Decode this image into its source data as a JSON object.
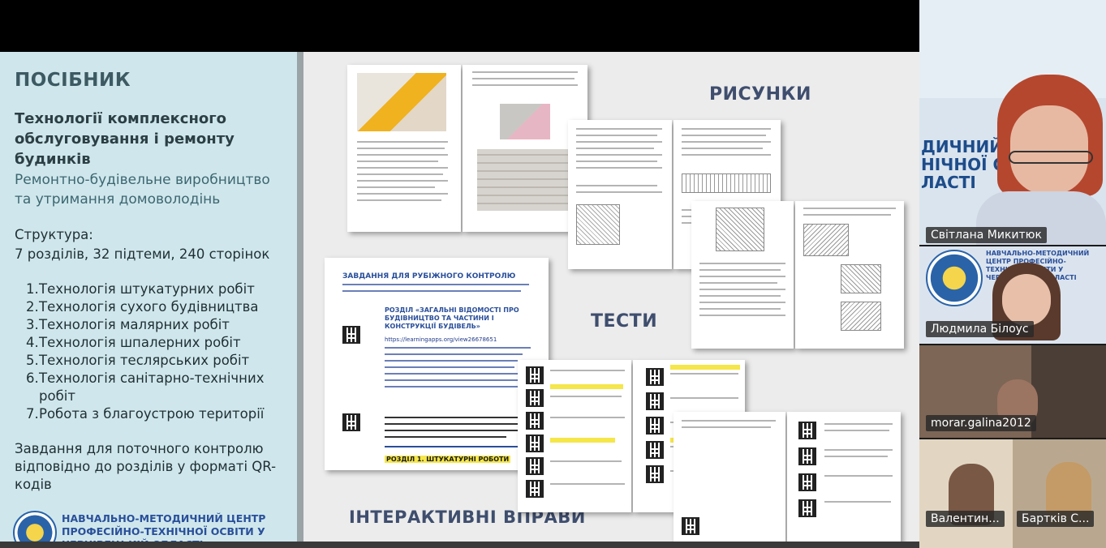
{
  "slide": {
    "left_panel": {
      "heading": "ПОСІБНИК",
      "title": "Технології комплексного обслуговування і ремонту будинків",
      "subtitle": "Ремонтно-будівельне виробництво та утримання домоволодінь",
      "structure_label": "Структура:",
      "structure_value": "7 розділів, 32 підтеми, 240 сторінок",
      "topics": [
        {
          "num": "1.",
          "text": "Технологія штукатурних робіт"
        },
        {
          "num": "2.",
          "text": "Технологія сухого будівництва"
        },
        {
          "num": "3.",
          "text": "Технологія малярних робіт"
        },
        {
          "num": "4.",
          "text": "Технологія шпалерних робіт"
        },
        {
          "num": "5.",
          "text": "Технологія теслярських робіт"
        },
        {
          "num": "6.",
          "text": "Технологія санітарно-технічних робіт"
        },
        {
          "num": "7.",
          "text": "Робота з благоустрою території"
        }
      ],
      "tasks": "Завдання для поточного контролю відповідно до розділів у форматі QR-кодів",
      "footer": "НАВЧАЛЬНО-МЕТОДИЧНИЙ ЦЕНТР ПРОФЕСІЙНО-ТЕХНІЧНОЇ ОСВІТИ У ЧЕРНІВЕЦЬКІЙ ОБЛАСТІ"
    },
    "labels": {
      "drawings": "РИСУНКИ",
      "tests": "ТЕСТИ",
      "interactive": "ІНТЕРАКТИВНІ ВПРАВИ"
    },
    "task_doc": {
      "title": "ЗАВДАННЯ ДЛЯ РУБІЖНОГО КОНТРОЛЮ",
      "section": "РОЗДІЛ «ЗАГАЛЬНІ ВІДОМОСТІ ПРО БУДІВНИЦТВО ТА ЧАСТИНИ І КОНСТРУКЦІЇ БУДІВЕЛЬ»",
      "url": "https://learningapps.org/view26678651",
      "section2": "РОЗДІЛ 1. ШТУКАТУРНІ РОБОТИ"
    }
  },
  "participants": {
    "tile1": {
      "name": "Світлана Микитюк",
      "wall_text": "ДИЧНИЙ ЦЕН\nНІЧНОЇ ОСВІТ\nЛАСТІ"
    },
    "tile2": {
      "name": "Людмила Білоус",
      "banner": "НАВЧАЛЬНО-МЕТОДИЧНИЙ ЦЕНТР ПРОФЕСІЙНО-ТЕХНІЧНОЇ ОСВІТИ У ЧЕРНІВЕЦЬКІЙ ОБЛАСТІ"
    },
    "tile3": {
      "name": "morar.galina2012"
    },
    "tile4": {
      "name_left": "Валентин...",
      "name_right": "Бартків С..."
    }
  },
  "colors": {
    "slide_panel": "#cfe7ec",
    "label": "#3f4e6e",
    "highlight": "#f5e64a"
  }
}
